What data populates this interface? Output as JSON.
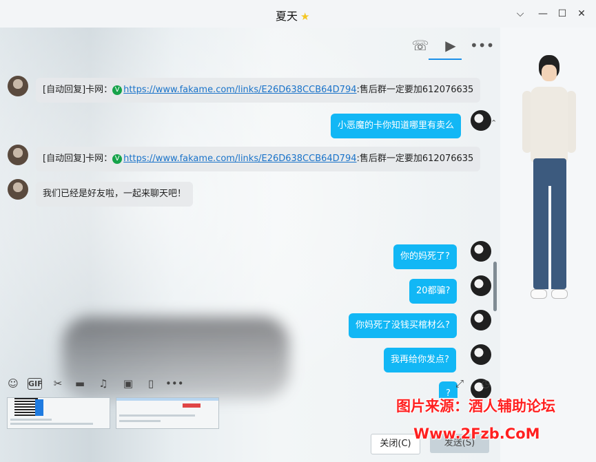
{
  "window": {
    "title": "夏天",
    "title_star": "★",
    "controls": {
      "menu": "⌵",
      "minimize": "—",
      "maximize": "☐",
      "close": "✕"
    }
  },
  "top_actions": {
    "call_icon": "☏",
    "video_icon": "▶",
    "more_icon": "•••"
  },
  "messages": [
    {
      "side": "in",
      "prefix": "[自动回复]卡网：",
      "link": "https://www.fakame.com/links/E26D638CCB64D794",
      "suffix": ":售后群一定要加612076635"
    },
    {
      "side": "out",
      "text": "小恶魔的卡你知道哪里有卖么"
    },
    {
      "side": "in",
      "prefix": "[自动回复]卡网：",
      "link": "https://www.fakame.com/links/E26D638CCB64D794",
      "suffix": ":售后群一定要加612076635"
    },
    {
      "side": "in",
      "text": "我们已经是好友啦，一起来聊天吧！"
    },
    {
      "side": "out",
      "text": "你的妈死了?"
    },
    {
      "side": "out",
      "text": "20都骗?"
    },
    {
      "side": "out",
      "text": "你妈死了没钱买棺材么?"
    },
    {
      "side": "out",
      "text": "我再给你发点?"
    },
    {
      "side": "out",
      "text": "?"
    }
  ],
  "verify_badge": "V",
  "toolbar": {
    "emoji_icon": "☺",
    "gif_label": "GIF",
    "scissors_icon": "✂",
    "folder_icon": "▬",
    "music_icon": "♫",
    "image_icon": "▣",
    "shake_icon": "▯",
    "more_icon": "•••",
    "expand_icon": "⤢",
    "history_icon": "◷"
  },
  "buttons": {
    "close": "关闭(C)",
    "send": "发送(S)"
  },
  "watermark": {
    "line1": "图片来源：酒人辅助论坛",
    "line2": "Www.2Fzb.CoM"
  }
}
